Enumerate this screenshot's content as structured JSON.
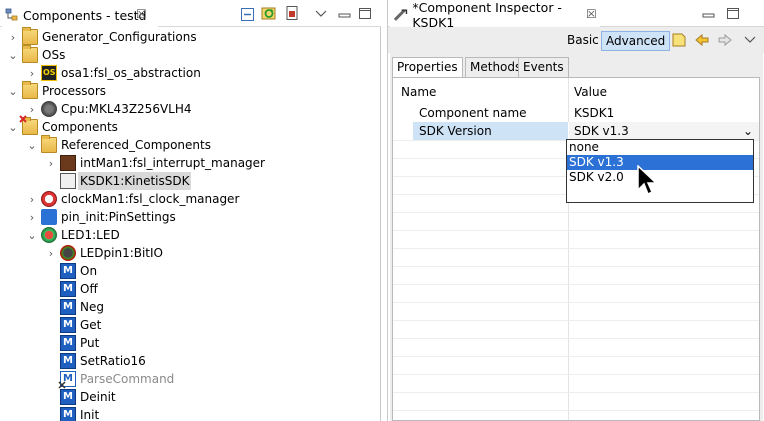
{
  "left_view": {
    "title": "Components - testd",
    "close_glyph": "☒",
    "toolbar_icons": [
      "collapse-all-icon",
      "refresh-icon",
      "export-icon",
      "view-menu-icon",
      "minimize-icon",
      "maximize-icon"
    ]
  },
  "tree": [
    {
      "label": "Generator_Configurations",
      "arrow": "›",
      "icon": "folder-icon"
    },
    {
      "label": "OSs",
      "arrow": "⌄",
      "icon": "folder-icon"
    },
    {
      "label": "osa1:fsl_os_abstraction",
      "arrow": "›",
      "icon": "osa-component-icon"
    },
    {
      "label": "Processors",
      "arrow": "⌄",
      "icon": "folder-icon"
    },
    {
      "label": "Cpu:MKL43Z256VLH4",
      "arrow": "›",
      "icon": "cpu-icon"
    },
    {
      "label": "Components",
      "arrow": "⌄",
      "icon": "components-folder-icon"
    },
    {
      "label": "Referenced_Components",
      "arrow": "⌄",
      "icon": "folder-icon"
    },
    {
      "label": "intMan1:fsl_interrupt_manager",
      "arrow": "›",
      "icon": "interrupt-manager-icon"
    },
    {
      "label": "KSDK1:KinetisSDK",
      "arrow": "",
      "icon": "ksdk-icon",
      "selected": true
    },
    {
      "label": "clockMan1:fsl_clock_manager",
      "arrow": "›",
      "icon": "clock-manager-icon"
    },
    {
      "label": "pin_init:PinSettings",
      "arrow": "›",
      "icon": "pin-settings-icon"
    },
    {
      "label": "LED1:LED",
      "arrow": "⌄",
      "icon": "led-icon"
    },
    {
      "label": "LEDpin1:BitIO",
      "arrow": "›",
      "icon": "bitio-icon"
    },
    {
      "label": "On",
      "arrow": "",
      "icon": "method-icon"
    },
    {
      "label": "Off",
      "arrow": "",
      "icon": "method-icon"
    },
    {
      "label": "Neg",
      "arrow": "",
      "icon": "method-icon"
    },
    {
      "label": "Get",
      "arrow": "",
      "icon": "method-icon"
    },
    {
      "label": "Put",
      "arrow": "",
      "icon": "method-icon"
    },
    {
      "label": "SetRatio16",
      "arrow": "",
      "icon": "method-icon"
    },
    {
      "label": "ParseCommand",
      "arrow": "",
      "icon": "method-disabled-icon",
      "disabled": true
    },
    {
      "label": "Deinit",
      "arrow": "",
      "icon": "method-icon"
    },
    {
      "label": "Init",
      "arrow": "",
      "icon": "method-icon"
    }
  ],
  "right_view": {
    "title": "*Component Inspector - KSDK1",
    "close_glyph": "☒",
    "toolbar": {
      "basic_label": "Basic",
      "advanced_label": "Advanced"
    },
    "tabs": [
      "Properties",
      "Methods",
      "Events"
    ],
    "columns": {
      "name": "Name",
      "value": "Value"
    },
    "rows": [
      {
        "name": "Component name",
        "value": "KSDK1"
      },
      {
        "name": "SDK Version",
        "value": "SDK v1.3"
      }
    ],
    "dropdown_arrow": "⌄",
    "dropdown_options": [
      "none",
      "SDK v1.3",
      "SDK v2.0"
    ],
    "selected_option": "SDK v1.3"
  },
  "colors": {
    "selection_blue": "#2c72d6",
    "active_toggle_bg": "#cfe3f7",
    "row_highlight": "#cfe3f7",
    "tree_selected": "#d9d9d9"
  }
}
